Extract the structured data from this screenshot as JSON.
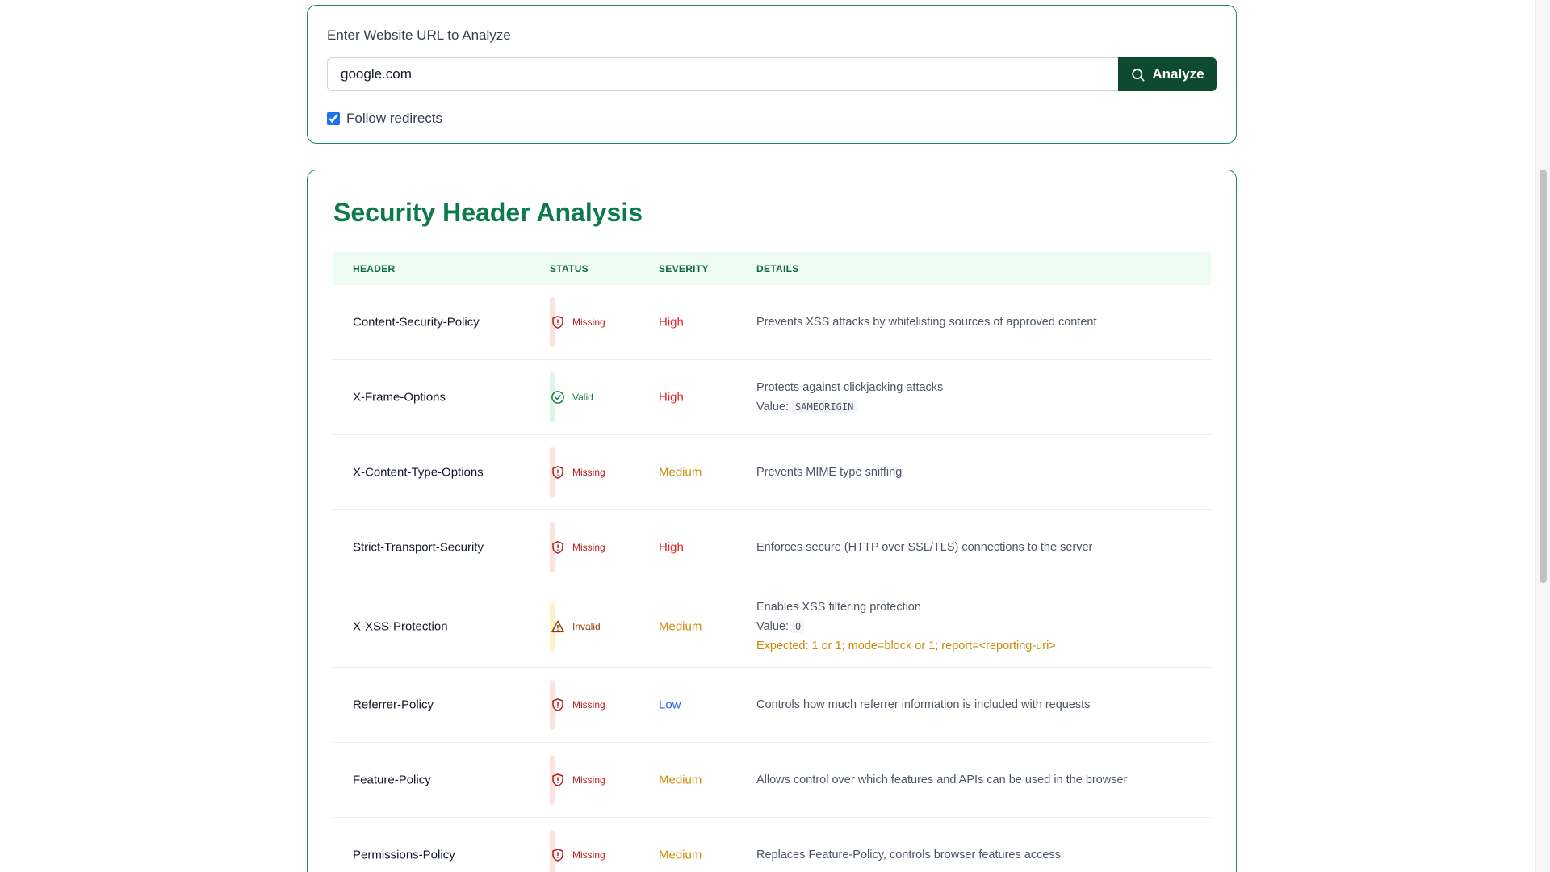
{
  "url_form": {
    "label": "Enter Website URL to Analyze",
    "url_value": "google.com",
    "analyze_label": "Analyze",
    "follow_redirects_label": "Follow redirects",
    "follow_redirects_checked": true
  },
  "analysis": {
    "title": "Security Header Analysis",
    "columns": [
      "HEADER",
      "STATUS",
      "SEVERITY",
      "DETAILS"
    ],
    "rows": [
      {
        "header": "Content-Security-Policy",
        "status": "Missing",
        "severity": "High",
        "details": "Prevents XSS attacks by whitelisting sources of approved content"
      },
      {
        "header": "X-Frame-Options",
        "status": "Valid",
        "severity": "High",
        "details": "Protects against clickjacking attacks",
        "value_label": "Value:",
        "value": "SAMEORIGIN"
      },
      {
        "header": "X-Content-Type-Options",
        "status": "Missing",
        "severity": "Medium",
        "details": "Prevents MIME type sniffing"
      },
      {
        "header": "Strict-Transport-Security",
        "status": "Missing",
        "severity": "High",
        "details": "Enforces secure (HTTP over SSL/TLS) connections to the server"
      },
      {
        "header": "X-XSS-Protection",
        "status": "Invalid",
        "severity": "Medium",
        "details": "Enables XSS filtering protection",
        "value_label": "Value:",
        "value": "0",
        "expected": "Expected: 1 or 1; mode=block or 1; report=<reporting-uri>"
      },
      {
        "header": "Referrer-Policy",
        "status": "Missing",
        "severity": "Low",
        "details": "Controls how much referrer information is included with requests"
      },
      {
        "header": "Feature-Policy",
        "status": "Missing",
        "severity": "Medium",
        "details": "Allows control over which features and APIs can be used in the browser"
      },
      {
        "header": "Permissions-Policy",
        "status": "Missing",
        "severity": "Medium",
        "details": "Replaces Feature-Policy, controls browser features access"
      }
    ]
  },
  "icons": {
    "analyze": "search-icon",
    "missing": "shield-alert-icon",
    "valid": "check-circle-icon",
    "invalid": "warning-triangle-icon"
  },
  "colors": {
    "brand_green": "#0d7a4c",
    "button_dark_green": "#0d4a31",
    "high": "#dc2626",
    "medium": "#d18a06",
    "low": "#2563eb"
  }
}
